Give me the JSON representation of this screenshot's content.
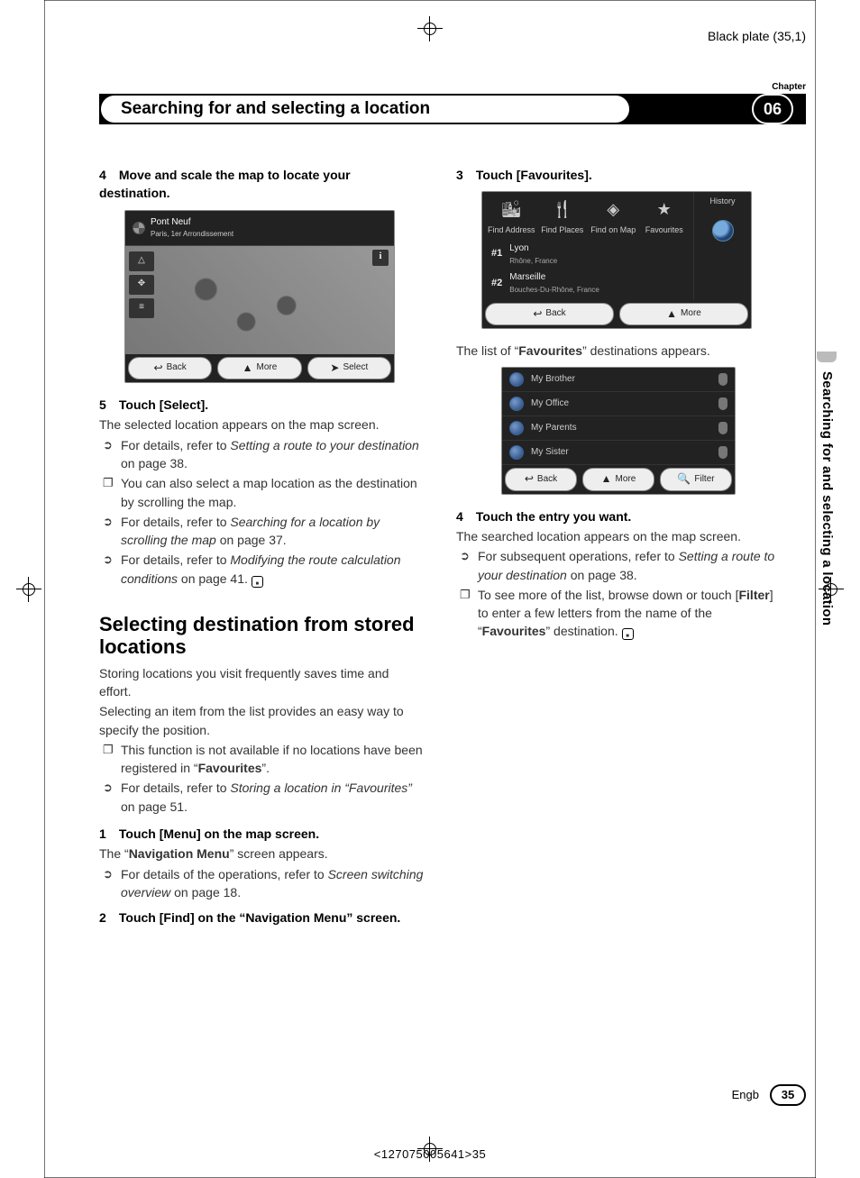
{
  "plate_info": "Black plate (35,1)",
  "chapter": {
    "label": "Chapter",
    "number": "06",
    "title": "Searching for and selecting a location"
  },
  "side_tab": "Searching for and selecting a location",
  "left": {
    "step4": {
      "num": "4",
      "title": "Move and scale the map to locate your destination.",
      "mock": {
        "title_line1": "Pont Neuf",
        "title_line2": "Paris, 1er Arrondissement",
        "back": "Back",
        "more": "More",
        "select": "Select"
      }
    },
    "step5": {
      "num": "5",
      "title": "Touch [Select].",
      "body": "The selected location appears on the map screen.",
      "n1a": "For details, refer to ",
      "n1b": "Setting a route to your destination",
      "n1c": " on page 38.",
      "n2": "You can also select a map location as the destination by scrolling the map.",
      "n3a": "For details, refer to ",
      "n3b": "Searching for a location by scrolling the map",
      "n3c": " on page 37.",
      "n4a": "For details, refer to ",
      "n4b": "Modifying the route calculation conditions",
      "n4c": " on page 41."
    },
    "section2_title": "Selecting destination from stored locations",
    "section2_p1": "Storing locations you visit frequently saves time and effort.",
    "section2_p2": "Selecting an item from the list provides an easy way to specify the position.",
    "section2_n1a": "This function is not available if no locations have been registered in “",
    "section2_n1b": "Favourites",
    "section2_n1c": "”.",
    "section2_n2a": "For details, refer to ",
    "section2_n2b": "Storing a location in “Favourites”",
    "section2_n2c": " on page 51.",
    "step1": {
      "num": "1",
      "title": "Touch [Menu] on the map screen.",
      "body_a": "The “",
      "body_b": "Navigation Menu",
      "body_c": "” screen appears.",
      "na": "For details of the operations, refer to ",
      "nb": "Screen switching overview",
      "nc": " on page 18."
    },
    "step2": {
      "num": "2",
      "title": "Touch [Find] on the “Navigation Menu” screen."
    }
  },
  "right": {
    "step3": {
      "num": "3",
      "title": "Touch [Favourites].",
      "mock": {
        "tiles": [
          "Find Address",
          "Find Places",
          "Find on Map",
          "Favourites"
        ],
        "hist": "History",
        "row1_t": "Lyon",
        "row1_s": "Rhône, France",
        "row2_t": "Marseille",
        "row2_s": "Bouches-Du-Rhône, France",
        "back": "Back",
        "more": "More"
      },
      "after_a": "The list of “",
      "after_b": "Favourites",
      "after_c": "” destinations appears.",
      "favs": [
        "My Brother",
        "My Office",
        "My Parents",
        "My Sister"
      ],
      "fav_back": "Back",
      "fav_more": "More",
      "fav_filter": "Filter"
    },
    "step4": {
      "num": "4",
      "title": "Touch the entry you want.",
      "body": "The searched location appears on the map screen.",
      "n1a": "For subsequent operations, refer to ",
      "n1b": "Setting a route to your destination",
      "n1c": " on page 38.",
      "n2a": "To see more of the list, browse down or touch [",
      "n2b": "Filter",
      "n2c": "] to enter a few letters from the name of the “",
      "n2d": "Favourites",
      "n2e": "” destination."
    }
  },
  "footer": {
    "lang": "Engb",
    "page": "35"
  },
  "barcode": "<127075005641>35"
}
